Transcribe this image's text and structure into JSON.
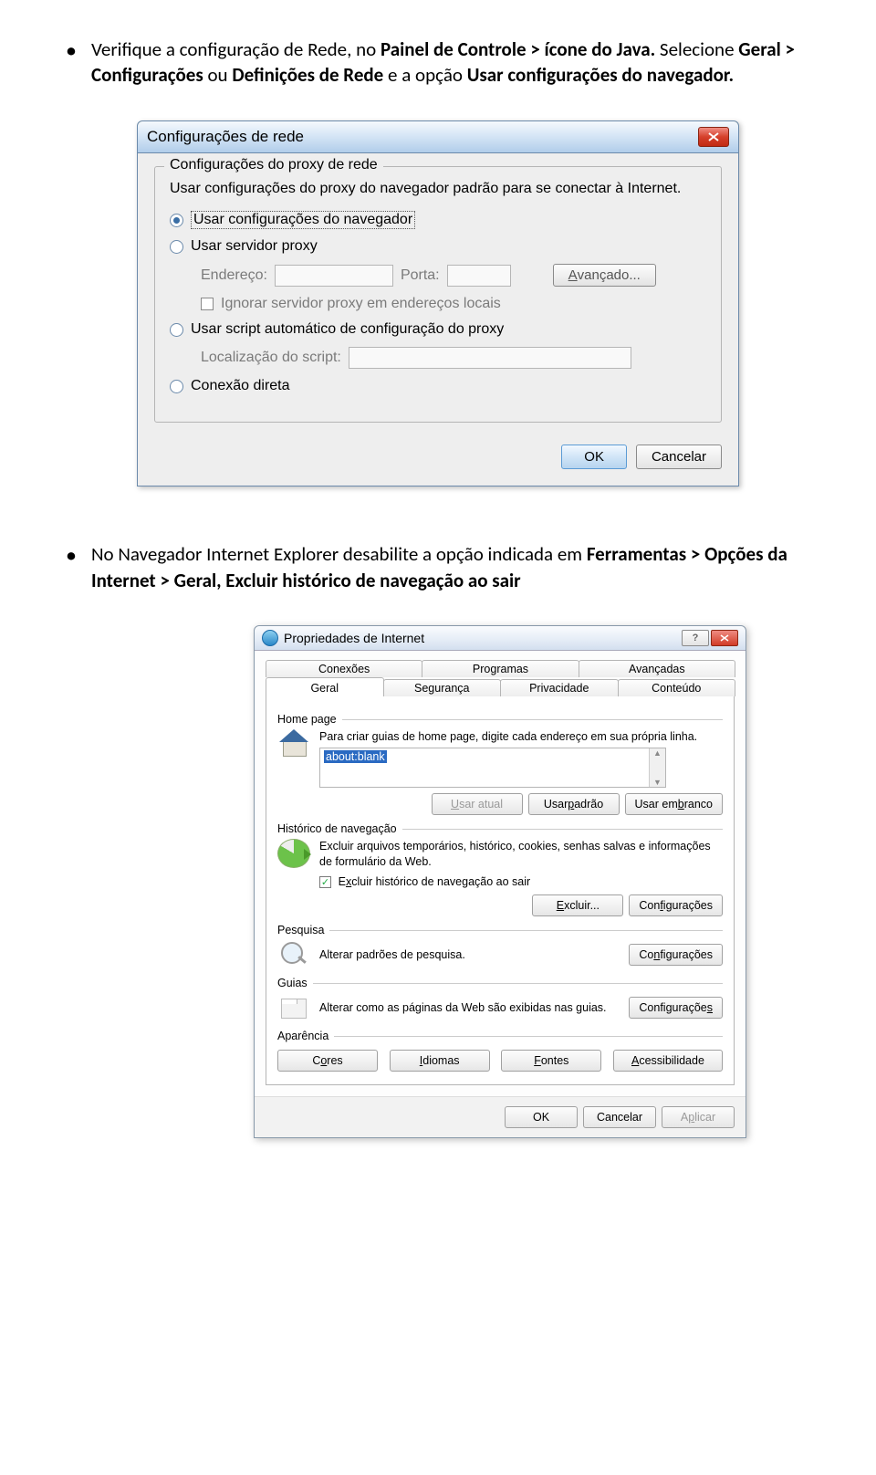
{
  "doc": {
    "bullet1a": "Verifique a configuração de Rede, no ",
    "bullet1b": "Painel de Controle > ícone do Java.",
    "bullet1c": " Selecione ",
    "bullet1d": "Geral > Configurações",
    "bullet1e": " ou ",
    "bullet1f": "Definições de Rede",
    "bullet1g": " e a opção ",
    "bullet1h": "Usar configurações do navegador.",
    "bullet2a": "No Navegador Internet Explorer desabilite a opção indicada em ",
    "bullet2b": "Ferramentas > Opções da Internet > Geral, Excluir histórico de navegação ao sair"
  },
  "dialog1": {
    "title": "Configurações de rede",
    "group_legend": "Configurações do proxy de rede",
    "desc": "Usar configurações do proxy do navegador padrão para se conectar à Internet.",
    "radio_browser": "Usar configurações do navegador",
    "radio_proxy": "Usar servidor proxy",
    "lbl_address": "Endereço:",
    "lbl_port": "Porta:",
    "btn_advanced": "Avançado...",
    "chk_ignore": "Ignorar servidor proxy em endereços locais",
    "radio_script": "Usar script automático de configuração do proxy",
    "lbl_script_loc": "Localização do script:",
    "radio_direct": "Conexão direta",
    "btn_ok": "OK",
    "btn_cancel": "Cancelar"
  },
  "dialog2": {
    "title": "Propriedades de Internet",
    "tabs_row1": [
      "Conexões",
      "Programas",
      "Avançadas"
    ],
    "tabs_row2": [
      "Geral",
      "Segurança",
      "Privacidade",
      "Conteúdo"
    ],
    "section_home": "Home page",
    "home_text": "Para criar guias de home page, digite cada endereço em sua própria linha.",
    "home_value": "about:blank",
    "btn_usar_atual": "Usar atual",
    "btn_usar_padrao": "Usar padrão",
    "btn_usar_branco": "Usar em branco",
    "section_history": "Histórico de navegação",
    "history_text": "Excluir arquivos temporários, histórico, cookies, senhas salvas e informações de formulário da Web.",
    "chk_exit": "Excluir histórico de navegação ao sair",
    "btn_excluir": "Excluir...",
    "btn_config": "Configurações",
    "section_search": "Pesquisa",
    "search_text": "Alterar padrões de pesquisa.",
    "section_tabs": "Guias",
    "tabs_text": "Alterar como as páginas da Web são exibidas nas guias.",
    "section_aparencia": "Aparência",
    "btn_cores": "Cores",
    "btn_idiomas": "Idiomas",
    "btn_fontes": "Fontes",
    "btn_acess": "Acessibilidade",
    "btn_ok": "OK",
    "btn_cancel": "Cancelar",
    "btn_apply": "Aplicar"
  }
}
